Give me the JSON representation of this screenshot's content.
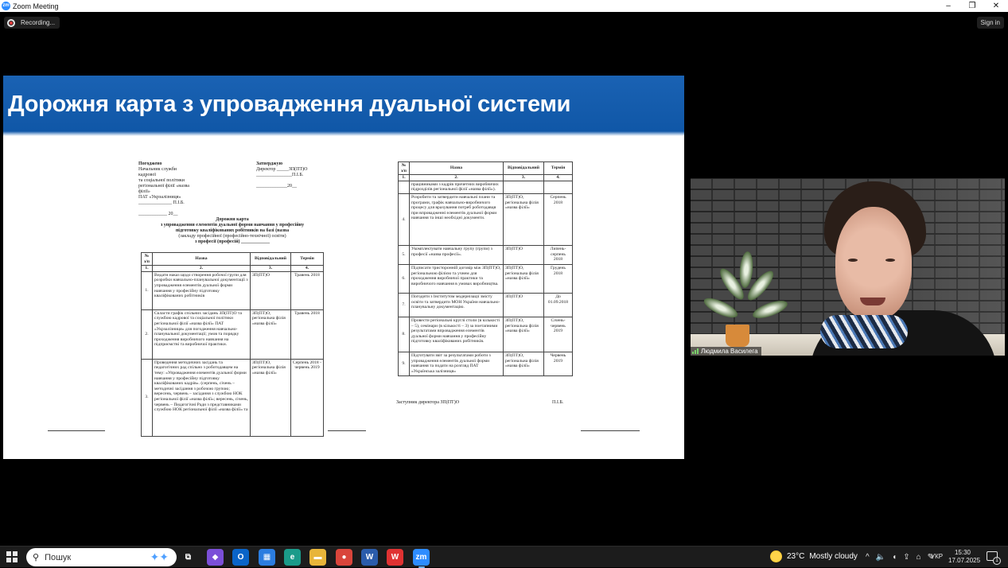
{
  "window": {
    "app_icon": "zm",
    "title": "Zoom Meeting",
    "controls": {
      "minimize": "–",
      "maximize": "❐",
      "close": "✕"
    }
  },
  "meeting": {
    "recording_label": "Recording...",
    "sign_in_label": "Sign in"
  },
  "slide": {
    "title": "Дорожня карта з упровадження дуальної системи",
    "doc_left": {
      "approved_left": {
        "heading": "Погоджено",
        "lines": [
          "Начальник служби кадрової",
          "та соціальної політики",
          "регіональної філії «назва філії»",
          "ПАТ «Укрзалізниця»",
          "______________ П.І.Б.",
          "",
          "____________ 20__"
        ]
      },
      "approved_right": {
        "heading": "Затверджую",
        "lines": [
          "Директор _____ЗП(ПТ)О",
          "_______________П.І.Б.",
          "",
          "_____________20__"
        ]
      },
      "doc_title": "Дорожня карта",
      "doc_subtitle_lines": [
        "з упровадження елементів дуальної форми навчання у професійну",
        "підготовку кваліфікованих робітників на базі (назва",
        "(закладу професійної (професійно-технічної) освіти)",
        "з професії (професій) ____________"
      ],
      "table": {
        "headers": [
          "№ з/п",
          "Назва",
          "Відповідальний",
          "Термін"
        ],
        "col_numbers": [
          "1.",
          "2.",
          "3.",
          "4."
        ],
        "rows": [
          {
            "num": "1.",
            "name": "Видати наказ щодо створення робочої групи для розробки навчально-планувальної документації з упровадження елементів дуальної форми навчання у професійну підготовку кваліфікованих робітників",
            "resp": "ЗП(ПТ)О",
            "term": "Травень 2018"
          },
          {
            "num": "2.",
            "name": "Скласти графік спільних засідань ЗП(ПТ)О та службою кадрової та соціальної політики регіональної філії «назва філії» ПАТ «Укрзалізниця» для погодження навчально-планувальної документації; умов та порядку проходження виробничого навчання на підприємстві та виробничої практики.",
            "resp": "ЗП(ПТ)О, регіональна філія «назва філії»",
            "term": "Травень 2018"
          },
          {
            "num": "3.",
            "name": "Проведення методичних засідань та педагогічних рад спільно з роботодавцем на тему: «Упровадження елементів дуальної форми навчання у професійну підготовку кваліфікованих кадрів». (серпень, січень – методичні засідання з робочою групою; вересень, червень – засідання з службою НОК регіональної філії «назва філії»; вересень, січень, червень – Педагогічні Ради з представниками службою НОК регіональної філії «назва філії» та",
            "resp": "ЗП(ПТ)О, регіональна філія «назва філії»",
            "term": "Серпень 2018 - червень 2019"
          }
        ]
      }
    },
    "doc_right": {
      "table": {
        "headers": [
          "№ з/п",
          "Назва",
          "Відповідальний",
          "Термін"
        ],
        "col_numbers": [
          "1.",
          "2.",
          "3.",
          "4."
        ],
        "rows": [
          {
            "num": "",
            "name": "працівниками з кадрів причетних виробничих підрозділів регіональної філії «назва філії»).",
            "resp": "",
            "term": ""
          },
          {
            "num": "4.",
            "name": "Розробити та затвердити навчальні плани та програми, графік навчально-виробничого процесу для врахування потреб роботодавця при впровадженні елементів дуальної форми навчання та інші необхідні документи.",
            "resp": "ЗП(ПТ)О, регіональна філія «назва філії»",
            "term": "Серпень 2018"
          },
          {
            "num": "5.",
            "name": "Укомплектувати навчальну групу (групи) з професії «назва професії».",
            "resp": "ЗП(ПТ)О",
            "term": "Липень-серпень 2018"
          },
          {
            "num": "6.",
            "name": "Підписати тристоронній договір між ЗП(ПТ)О, регіональною філією та учнем для проходження виробничої практики та виробничого навчання в умовах виробництва.",
            "resp": "ЗП(ПТ)О, регіональна філія «назва філії»",
            "term": "Грудень 2018"
          },
          {
            "num": "7.",
            "name": "Погодити з Інститутом модернізації змісту освіти та затвердити МОН України навчально-планувальну документацію.",
            "resp": "ЗП(ПТ)О",
            "term": "До 01.09.2018"
          },
          {
            "num": "8.",
            "name": "Провести регіональні круглі столи (в кількості – 5), семінари (в кількості – 3) за поетапними результатами впровадження елементів дуальної форми навчання у професійну підготовку кваліфікованих робітників.",
            "resp": "ЗП(ПТ)О, регіональна філія «назва філії»",
            "term": "Січень-червень 2019"
          },
          {
            "num": "9.",
            "name": "Підготувати звіт за результатами роботи з упровадження елементів дуальної форми навчання та подати на розгляд ПАТ «Українська залізниця»",
            "resp": "ЗП(ПТ)О, регіональна філія «назва філії»",
            "term": "Червень 2019"
          }
        ]
      },
      "signature_left": "Заступник директора ЗП(ПТ)О",
      "signature_right": "П.І.Б."
    }
  },
  "participant": {
    "name": "Людмила Василега"
  },
  "taskbar": {
    "search_label": "Пошук",
    "weather_temp": "23°C",
    "weather_text": "Mostly cloudy",
    "language": "УКР",
    "time": "15:30",
    "date": "17.07.2025",
    "notification_count": "1",
    "apps": [
      {
        "name": "task-view-icon",
        "glyph": "⧉",
        "color": "#1c1c1c"
      },
      {
        "name": "copilot-icon",
        "glyph": "◆",
        "color": "#7b4fd8"
      },
      {
        "name": "outlook-icon",
        "glyph": "O",
        "color": "#0a64c8"
      },
      {
        "name": "store-icon",
        "glyph": "▦",
        "color": "#2b7de0"
      },
      {
        "name": "edge-icon",
        "glyph": "e",
        "color": "#1b9b8a"
      },
      {
        "name": "file-explorer-icon",
        "glyph": "▬",
        "color": "#e8b53a"
      },
      {
        "name": "chrome-icon",
        "glyph": "●",
        "color": "#d9453b"
      },
      {
        "name": "word-icon",
        "glyph": "W",
        "color": "#2b5cab"
      },
      {
        "name": "wps-icon",
        "glyph": "W",
        "color": "#e03232"
      },
      {
        "name": "zoom-icon",
        "glyph": "zm",
        "color": "#2d8cff"
      }
    ],
    "tray_icons": [
      "^",
      "🔈",
      "◖",
      "⇪",
      "⌂",
      "✎"
    ]
  },
  "colors": {
    "slide_header": "#1a62b3",
    "zoom_blue": "#2d8cff",
    "taskbar_bg": "#1c1c1c"
  }
}
